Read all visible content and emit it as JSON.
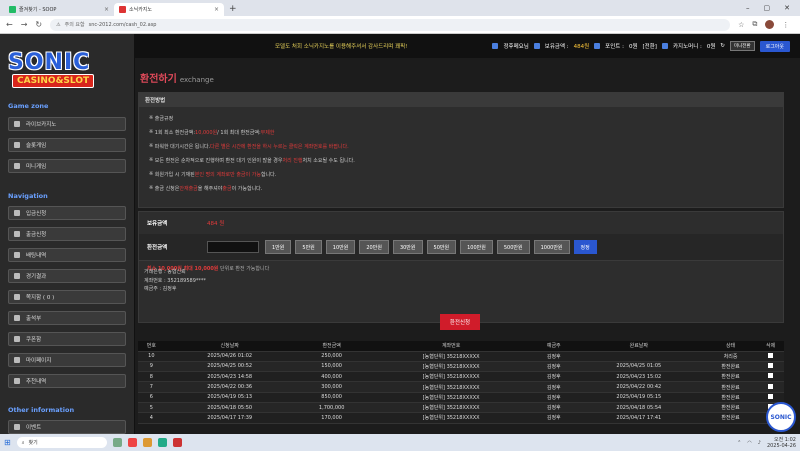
{
  "browser": {
    "tabs": [
      {
        "label": "즐겨찾기 - SOOP"
      },
      {
        "label": "소닉카지노"
      }
    ],
    "url_warning": "주의 요함",
    "url": "snc-2012.com/cash_02.asp"
  },
  "sidebar": {
    "logo_main": "SONIC",
    "logo_sub": "CASINO&SLOT",
    "sections": {
      "game": "Game zone",
      "nav": "Navigation",
      "info": "Other information"
    },
    "game_items": [
      "라이브카지노",
      "슬롯게임",
      "미니게임"
    ],
    "nav_items": [
      "입금신청",
      "출금신청",
      "배팅내역",
      "경기결과",
      "쪽지함 ( 0 )",
      "출석부",
      "쿠폰함",
      "마이페이지",
      "추천내역"
    ],
    "info_items": [
      "이벤트"
    ]
  },
  "topbar": {
    "marquee": "모델도 처회 소닉카지노를 이용해주셔서 감사드리며 꽤픽!",
    "user": "정후메요님",
    "balance_label": "보유금액 :",
    "balance": "484원",
    "point_label": "포인트 :",
    "point": "0원",
    "point_btn": "[전환]",
    "casino_label": "카지노머니 :",
    "casino": "0원",
    "mini_btn": "미니전환",
    "logout": "로그아웃"
  },
  "page": {
    "title": "환전하기",
    "subtitle": "exchange"
  },
  "rules": {
    "head": "환전방법",
    "items": [
      {
        "text": "출금규정",
        "red": ""
      },
      {
        "text": "1회 최소 환전금액: ",
        "red": "10,000원",
        "tail": " / 1회 최대 환전금액: ",
        "red2": "무제한"
      },
      {
        "text": "파워한 대기시간은 됩니다. ",
        "red": "다른 별은 시간에 환전을 하시 누르는 클릭은 계좌번호를 바뀝니다."
      },
      {
        "text": "모든 환전은 순차적으로 진행하며 환전 대기 인원이 많을 경우 ",
        "red": "처리 진행",
        "tail": " 처치 소요될 수도 됩니다."
      },
      {
        "text": "회원가입 시 기재된 ",
        "red": "본인 명의 계좌로만 출금이 가능",
        "tail": "합니다."
      },
      {
        "text": "출금 신청은 ",
        "red": "안재출금",
        "tail": "을 해주셔야 ",
        "red2": "출금",
        "tail2": "이 가능합니다."
      }
    ]
  },
  "form": {
    "balance_label": "보유금액",
    "balance": "484 원",
    "amount_label": "환전금액",
    "amounts": [
      "1만원",
      "5만원",
      "10만원",
      "20만원",
      "30만원",
      "50만원",
      "100만원",
      "500만원",
      "1000만원"
    ],
    "reset": "정정",
    "note_red": "최소 10,000원 최대 10,000원",
    "note_gray": "단위로 환전 가능합니다"
  },
  "account": {
    "bank": "거래은행 : 농협신뢰",
    "number": "계좌번호 : 352189589****",
    "holder": "예금주 : 김정후"
  },
  "apply": "환전신청",
  "table": {
    "headers": [
      "번호",
      "신청날짜",
      "환전금액",
      "계좌번호",
      "예금주",
      "완료날짜",
      "상태",
      "삭제"
    ],
    "rows": [
      [
        "10",
        "2025/04/26 01:02",
        "250,000",
        "[농협단위] 35218XXXXX",
        "김정후",
        "",
        "처리중"
      ],
      [
        "9",
        "2025/04/25 00:52",
        "150,000",
        "[농협단위] 35218XXXXX",
        "김정후",
        "2025/04/25 01:05",
        "환전완료"
      ],
      [
        "8",
        "2025/04/23 14:58",
        "400,000",
        "[농협단위] 35218XXXXX",
        "김정후",
        "2025/04/23 15:02",
        "환전완료"
      ],
      [
        "7",
        "2025/04/22 00:36",
        "300,000",
        "[농협단위] 35218XXXXX",
        "김정후",
        "2025/04/22 00:42",
        "환전완료"
      ],
      [
        "6",
        "2025/04/19 05:13",
        "850,000",
        "[농협단위] 35218XXXXX",
        "김정후",
        "2025/04/19 05:15",
        "환전완료"
      ],
      [
        "5",
        "2025/04/18 05:50",
        "1,700,000",
        "[농협단위] 35218XXXXX",
        "김정후",
        "2025/04/18 05:54",
        "환전완료"
      ],
      [
        "4",
        "2025/04/17 17:39",
        "170,000",
        "[농협단위] 35218XXXXX",
        "김정후",
        "2025/04/17 17:41",
        "환전완료"
      ]
    ]
  },
  "taskbar": {
    "search": "찾기",
    "clock_time": "오전 1:02",
    "clock_date": "2025-04-26"
  },
  "badge": "SONIC"
}
